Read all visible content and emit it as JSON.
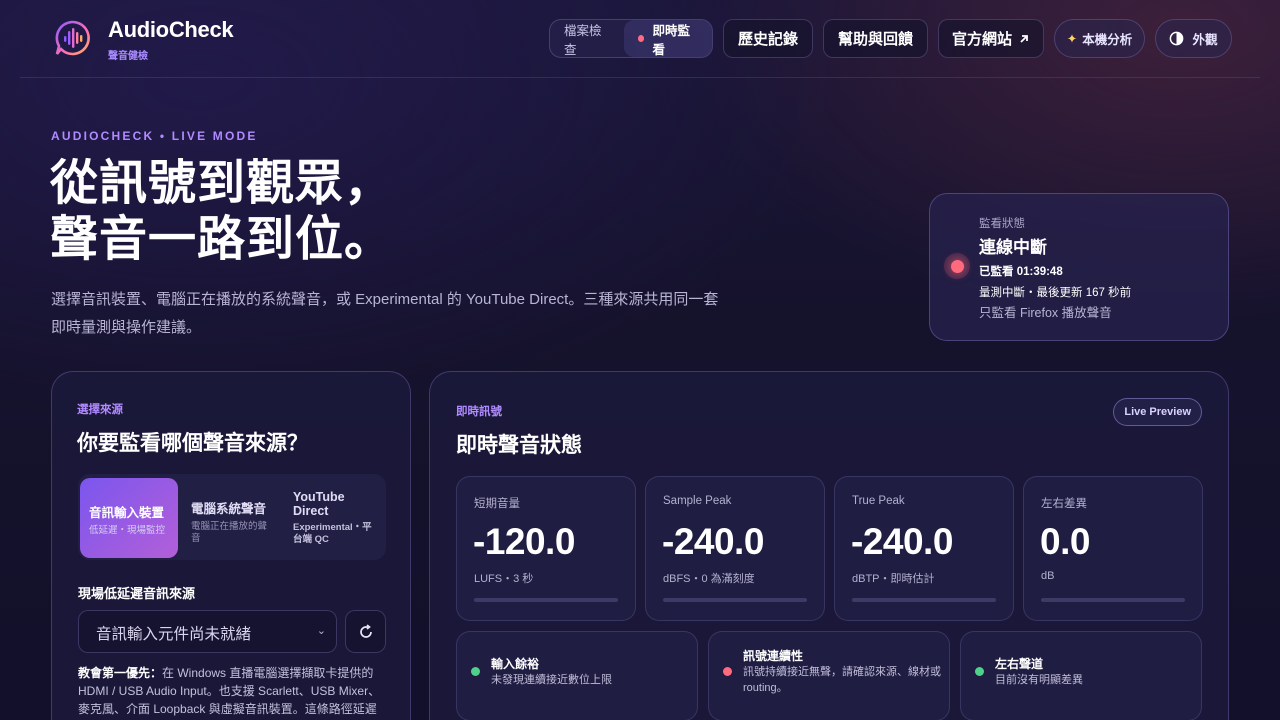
{
  "brand": {
    "name": "AudioCheck",
    "subtitle": "聲音健檢"
  },
  "nav": {
    "mode_files": "檔案檢查",
    "mode_live": "即時監看",
    "history": "歷史記錄",
    "help": "幫助與回饋",
    "website": "官方網站",
    "local_analysis": "本機分析",
    "appearance": "外觀"
  },
  "hero": {
    "eyebrow": "AUDIOCHECK • LIVE MODE",
    "title_line1": "從訊號到觀眾，",
    "title_line2": "聲音一路到位。",
    "desc_line1": "選擇音訊裝置、電腦正在播放的系統聲音，或 Experimental 的 YouTube Direct。三種來源共用同一套",
    "desc_line2": "即時量測與操作建議。"
  },
  "status": {
    "label": "監看狀態",
    "title": "連線中斷",
    "elapsed": "已監看 01:39:48",
    "detail": "量測中斷・最後更新 167 秒前",
    "scope": "只監看 Firefox 播放聲音",
    "color": "#ff6b7d"
  },
  "source": {
    "eyebrow": "選擇來源",
    "title": "你要監看哪個聲音來源？",
    "tabs": [
      {
        "title": "音訊輸入裝置",
        "desc": "低延遲・現場監控"
      },
      {
        "title": "電腦系統聲音",
        "desc": "電腦正在播放的聲音"
      },
      {
        "title": "YouTube Direct",
        "desc": "Experimental・平台端 QC"
      }
    ],
    "section_title": "現場低延遲音訊來源",
    "select_value": "音訊輸入元件尚未就緒",
    "note_bold": "教會第一優先：",
    "note_text": "在 Windows 直播電腦選擇擷取卡提供的 HDMI / USB Audio Input。也支援 Scarlett、USB Mixer、麥克風、介面 Loopback 與虛擬音訊裝置。這條路徑延遲"
  },
  "live": {
    "eyebrow": "即時訊號",
    "title": "即時聲音狀態",
    "badge": "Live Preview",
    "metrics": [
      {
        "label": "短期音量",
        "value": "-120.0",
        "unit": "LUFS・3 秒",
        "level": 0
      },
      {
        "label": "Sample Peak",
        "value": "-240.0",
        "unit": "dBFS・0 為滿刻度",
        "level": 0
      },
      {
        "label": "True Peak",
        "value": "-240.0",
        "unit": "dBTP・即時估計",
        "level": 0
      },
      {
        "label": "左右差異",
        "value": "0.0",
        "unit": "dB",
        "level": 0
      }
    ],
    "checks": [
      {
        "title": "輸入餘裕",
        "desc": "未發現連續接近數位上限",
        "color": "#4fd18b"
      },
      {
        "title": "訊號連續性",
        "desc": "訊號持續接近無聲，請確認來源、線材或 routing。",
        "color": "#ff6b7d"
      },
      {
        "title": "左右聲道",
        "desc": "目前沒有明顯差異",
        "color": "#4fd18b"
      }
    ]
  }
}
